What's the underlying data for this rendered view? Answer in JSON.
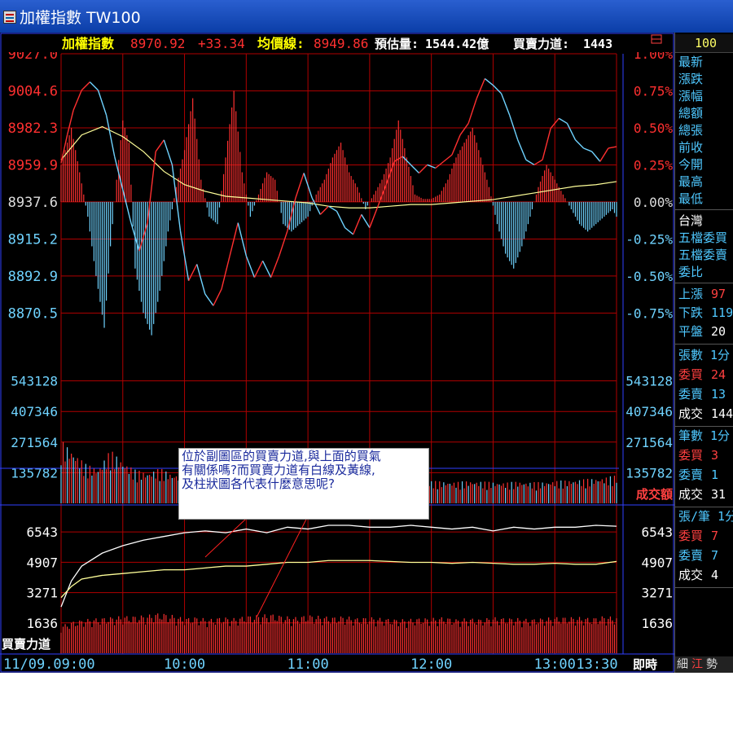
{
  "window": {
    "title": "加權指數 TW100"
  },
  "header": {
    "index_name": "加權指數",
    "last_price": "8970.92",
    "change": "+33.34",
    "avg_line_label": "均價線:",
    "avg_line_value": "8949.86",
    "est_volume_label": "預估量:",
    "est_volume_value": "1544.42億",
    "power_label": "買賣力道:",
    "power_value": "1443",
    "symbol": "100"
  },
  "panels": {
    "volume_label": "成交額",
    "power_label": "買賣力道",
    "realtime_label": "即時"
  },
  "callout": {
    "line1": "位於副圖區的買賣力道,與上面的買氣",
    "line2": "有關係嗎?而買賣力道有白線及黃線,",
    "line3": "及柱狀圖各代表什麼意思呢?"
  },
  "side_panel": {
    "quote_labels": [
      "最新",
      "漲跌",
      "漲幅",
      "總額",
      "總張",
      "前收",
      "今開",
      "最高",
      "最低"
    ],
    "market_title": "台灣",
    "market_labels": [
      "五檔委買",
      "五檔委賣",
      "委比"
    ],
    "adv_rows": [
      {
        "label": "上漲",
        "value": "97"
      },
      {
        "label": "下跌",
        "value": "119"
      },
      {
        "label": "平盤",
        "value": "20"
      }
    ],
    "lot_header": "張數 1分",
    "lot_rows": [
      {
        "label": "委買",
        "value": "24"
      },
      {
        "label": "委賣",
        "value": "13"
      },
      {
        "label": "成交",
        "value": "144"
      }
    ],
    "order_header": "筆數 1分",
    "order_rows": [
      {
        "label": "委買",
        "value": "3"
      },
      {
        "label": "委賣",
        "value": "1"
      },
      {
        "label": "成交",
        "value": "31"
      }
    ],
    "ratio_header": "張/筆 1分",
    "ratio_rows": [
      {
        "label": "委買",
        "value": "7"
      },
      {
        "label": "委賣",
        "value": "7"
      },
      {
        "label": "成交",
        "value": "4"
      }
    ],
    "tabs": [
      "細",
      "江",
      "勢"
    ]
  },
  "colors": {
    "bg": "#000000",
    "grid": "#b00000",
    "up": "#ff3030",
    "down": "#6fd3ff",
    "avg": "#ffff99",
    "white": "#ffffff",
    "yellow_text": "#ffff00",
    "border": "#3040ff"
  },
  "chart_data": [
    {
      "type": "line",
      "name": "price",
      "date": "11/09",
      "x_labels": [
        "11/09.09:00",
        "10:00",
        "11:00",
        "12:00",
        "13:00",
        "13:30"
      ],
      "y_labels": [
        "9027.0",
        "9004.6",
        "8982.3",
        "8959.9",
        "8937.6",
        "8915.2",
        "8892.9",
        "8870.5"
      ],
      "y_values": [
        9027.0,
        9004.6,
        8982.3,
        8959.9,
        8937.6,
        8915.2,
        8892.9,
        8870.5
      ],
      "pct_labels": [
        "1.00%",
        "0.75%",
        "0.50%",
        "0.25%",
        "0.00%",
        "-0.25%",
        "-0.50%",
        "-0.75%"
      ],
      "ylim": [
        8848.1,
        9027.0
      ],
      "reference": 8937.6,
      "price_series": {
        "t": [
          0,
          3,
          6,
          10,
          14,
          18,
          22,
          26,
          30,
          34,
          38,
          42,
          46,
          50,
          54,
          58,
          62,
          66,
          70,
          74,
          78,
          82,
          86,
          90,
          94,
          98,
          102,
          106,
          110,
          114,
          118,
          122,
          126,
          130,
          134,
          138,
          142,
          146,
          150,
          154,
          158,
          162,
          166,
          170,
          174,
          178,
          182,
          186,
          190,
          194,
          198,
          202,
          206,
          210,
          214,
          218,
          222,
          226,
          230,
          234,
          238,
          242,
          246,
          250,
          254,
          258,
          262,
          266,
          270
        ],
        "v": [
          8961,
          8978,
          8993,
          9005,
          9010,
          9005,
          8990,
          8965,
          8945,
          8925,
          8908,
          8925,
          8968,
          8975,
          8960,
          8920,
          8890,
          8900,
          8882,
          8875,
          8885,
          8905,
          8925,
          8905,
          8892,
          8902,
          8892,
          8905,
          8920,
          8940,
          8955,
          8940,
          8930,
          8935,
          8932,
          8922,
          8918,
          8930,
          8922,
          8935,
          8948,
          8962,
          8965,
          8960,
          8955,
          8960,
          8958,
          8962,
          8966,
          8978,
          8985,
          9000,
          9012,
          9008,
          9003,
          8990,
          8975,
          8963,
          8960,
          8963,
          8982,
          8988,
          8985,
          8975,
          8970,
          8968,
          8962,
          8970,
          8970.92
        ]
      },
      "avg_series": {
        "t": [
          0,
          10,
          20,
          30,
          40,
          50,
          60,
          70,
          80,
          90,
          100,
          110,
          120,
          130,
          140,
          150,
          160,
          170,
          180,
          190,
          200,
          210,
          220,
          230,
          240,
          250,
          260,
          270
        ],
        "v": [
          8963,
          8978,
          8983,
          8977,
          8968,
          8956,
          8948,
          8944,
          8941,
          8940,
          8939,
          8938,
          8937,
          8935,
          8934,
          8934,
          8935,
          8936,
          8936,
          8937,
          8938,
          8939,
          8941,
          8943,
          8945,
          8947,
          8948,
          8949.86
        ]
      },
      "buying_pressure_bars": {
        "t": [
          0,
          5,
          9,
          13,
          17,
          21,
          24,
          27,
          30,
          33,
          36,
          40,
          44,
          48,
          52,
          56,
          60,
          64,
          68,
          72,
          76,
          80,
          84,
          88,
          92,
          96,
          100,
          104,
          108,
          112,
          116,
          120,
          124,
          128,
          132,
          136,
          140,
          144,
          148,
          152,
          156,
          160,
          164,
          168,
          172,
          176,
          180,
          184,
          188,
          192,
          196,
          200,
          204,
          208,
          212,
          216,
          220,
          224,
          228,
          232,
          236,
          240,
          244,
          248,
          252,
          256,
          260,
          264,
          268,
          270
        ],
        "v": [
          0.25,
          0.5,
          0.2,
          -0.1,
          -0.5,
          -0.85,
          -0.3,
          0.15,
          0.55,
          0.4,
          -0.45,
          -0.75,
          -0.9,
          -0.6,
          -0.2,
          0.1,
          0.35,
          0.7,
          0.15,
          -0.1,
          -0.15,
          0.3,
          0.75,
          0.2,
          -0.1,
          0.05,
          0.2,
          0.15,
          -0.15,
          -0.2,
          -0.15,
          -0.1,
          0.05,
          0.15,
          0.3,
          0.4,
          0.2,
          0.1,
          -0.05,
          0.05,
          0.15,
          0.3,
          0.55,
          0.3,
          0.05,
          0.02,
          0.02,
          0.05,
          0.15,
          0.3,
          0.4,
          0.5,
          0.3,
          0.1,
          -0.15,
          -0.35,
          -0.45,
          -0.3,
          -0.1,
          0.1,
          0.25,
          0.15,
          0.05,
          -0.05,
          -0.15,
          -0.2,
          -0.15,
          -0.1,
          -0.05,
          -0.1
        ]
      }
    },
    {
      "type": "bar",
      "name": "成交額",
      "y_labels": [
        "543128",
        "407346",
        "271564",
        "135782"
      ],
      "y_values": [
        543128,
        407346,
        271564,
        135782
      ],
      "ylim": [
        0,
        679000
      ],
      "volume": {
        "t": [
          0,
          6,
          12,
          18,
          24,
          30,
          36,
          42,
          48,
          54,
          60,
          66,
          72,
          78,
          84,
          90,
          96,
          102,
          108,
          114,
          120,
          126,
          132,
          138,
          144,
          150,
          156,
          162,
          168,
          174,
          180,
          186,
          192,
          198,
          204,
          210,
          216,
          222,
          228,
          234,
          240,
          246,
          252,
          258,
          264,
          270
        ],
        "v": [
          225000,
          185000,
          140000,
          125000,
          190000,
          150000,
          120000,
          110000,
          125000,
          105000,
          100000,
          95000,
          100000,
          95000,
          90000,
          92000,
          85000,
          88000,
          90000,
          85000,
          84000,
          86000,
          85000,
          82000,
          83000,
          85000,
          82000,
          80000,
          82000,
          78000,
          80000,
          78000,
          76000,
          80000,
          78000,
          76000,
          74000,
          78000,
          75000,
          76000,
          80000,
          82000,
          85000,
          88000,
          92000,
          100000
        ]
      }
    },
    {
      "type": "line",
      "name": "買賣力道",
      "y_labels": [
        "6543",
        "4907",
        "3271",
        "1636"
      ],
      "y_values": [
        6543,
        4907,
        3271,
        1636
      ],
      "ylim": [
        0,
        8000
      ],
      "white_series": {
        "t": [
          0,
          5,
          10,
          20,
          30,
          40,
          50,
          60,
          70,
          80,
          90,
          100,
          110,
          120,
          130,
          140,
          150,
          160,
          170,
          180,
          190,
          200,
          210,
          220,
          230,
          240,
          250,
          260,
          270
        ],
        "v": [
          2500,
          3900,
          4700,
          5400,
          5800,
          6100,
          6300,
          6500,
          6600,
          6500,
          6700,
          6500,
          6800,
          6700,
          6900,
          6900,
          6800,
          6800,
          6900,
          6800,
          6700,
          6800,
          6600,
          6800,
          6700,
          6800,
          6800,
          6900,
          6850
        ]
      },
      "yellow_series": {
        "t": [
          0,
          5,
          10,
          20,
          30,
          40,
          50,
          60,
          70,
          80,
          90,
          100,
          110,
          120,
          130,
          140,
          150,
          160,
          170,
          180,
          190,
          200,
          210,
          220,
          230,
          240,
          250,
          260,
          270
        ],
        "v": [
          3000,
          3600,
          4000,
          4200,
          4300,
          4400,
          4500,
          4500,
          4600,
          4700,
          4700,
          4800,
          4900,
          4900,
          5000,
          5000,
          5000,
          4950,
          4900,
          4900,
          4850,
          4900,
          4850,
          4800,
          4800,
          4850,
          4800,
          4800,
          4950
        ]
      },
      "bars": {
        "t": [
          0,
          6,
          12,
          18,
          24,
          30,
          36,
          42,
          48,
          54,
          60,
          66,
          72,
          78,
          84,
          90,
          96,
          102,
          108,
          114,
          120,
          126,
          132,
          138,
          144,
          150,
          156,
          162,
          168,
          174,
          180,
          186,
          192,
          198,
          204,
          210,
          216,
          222,
          228,
          234,
          240,
          246,
          252,
          258,
          264,
          270
        ],
        "v": [
          1300,
          1500,
          1600,
          1650,
          1700,
          1750,
          1750,
          1800,
          1900,
          1800,
          1650,
          1700,
          1600,
          1700,
          1650,
          1750,
          1800,
          1850,
          1750,
          1700,
          1800,
          1750,
          1700,
          1750,
          1650,
          1700,
          1650,
          1600,
          1600,
          1650,
          1650,
          1700,
          1600,
          1650,
          1600,
          1700,
          1650,
          1650,
          1600,
          1650,
          1700,
          1700,
          1700,
          1650,
          1750,
          1700
        ]
      }
    }
  ]
}
